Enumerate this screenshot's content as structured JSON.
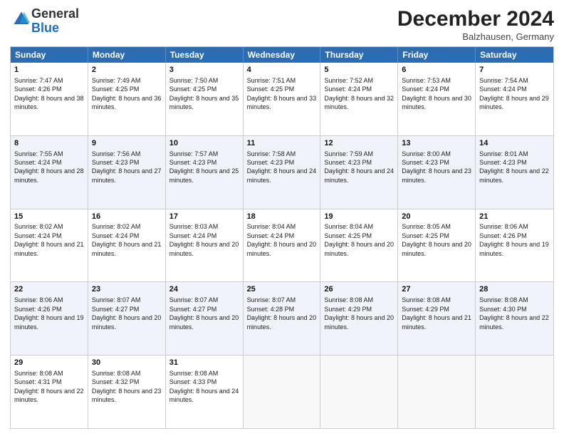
{
  "header": {
    "logo_general": "General",
    "logo_blue": "Blue",
    "month_title": "December 2024",
    "location": "Balzhausen, Germany"
  },
  "days_of_week": [
    "Sunday",
    "Monday",
    "Tuesday",
    "Wednesday",
    "Thursday",
    "Friday",
    "Saturday"
  ],
  "weeks": [
    [
      {
        "day": "1",
        "sunrise": "Sunrise: 7:47 AM",
        "sunset": "Sunset: 4:26 PM",
        "daylight": "Daylight: 8 hours and 38 minutes."
      },
      {
        "day": "2",
        "sunrise": "Sunrise: 7:49 AM",
        "sunset": "Sunset: 4:25 PM",
        "daylight": "Daylight: 8 hours and 36 minutes."
      },
      {
        "day": "3",
        "sunrise": "Sunrise: 7:50 AM",
        "sunset": "Sunset: 4:25 PM",
        "daylight": "Daylight: 8 hours and 35 minutes."
      },
      {
        "day": "4",
        "sunrise": "Sunrise: 7:51 AM",
        "sunset": "Sunset: 4:25 PM",
        "daylight": "Daylight: 8 hours and 33 minutes."
      },
      {
        "day": "5",
        "sunrise": "Sunrise: 7:52 AM",
        "sunset": "Sunset: 4:24 PM",
        "daylight": "Daylight: 8 hours and 32 minutes."
      },
      {
        "day": "6",
        "sunrise": "Sunrise: 7:53 AM",
        "sunset": "Sunset: 4:24 PM",
        "daylight": "Daylight: 8 hours and 30 minutes."
      },
      {
        "day": "7",
        "sunrise": "Sunrise: 7:54 AM",
        "sunset": "Sunset: 4:24 PM",
        "daylight": "Daylight: 8 hours and 29 minutes."
      }
    ],
    [
      {
        "day": "8",
        "sunrise": "Sunrise: 7:55 AM",
        "sunset": "Sunset: 4:24 PM",
        "daylight": "Daylight: 8 hours and 28 minutes."
      },
      {
        "day": "9",
        "sunrise": "Sunrise: 7:56 AM",
        "sunset": "Sunset: 4:23 PM",
        "daylight": "Daylight: 8 hours and 27 minutes."
      },
      {
        "day": "10",
        "sunrise": "Sunrise: 7:57 AM",
        "sunset": "Sunset: 4:23 PM",
        "daylight": "Daylight: 8 hours and 25 minutes."
      },
      {
        "day": "11",
        "sunrise": "Sunrise: 7:58 AM",
        "sunset": "Sunset: 4:23 PM",
        "daylight": "Daylight: 8 hours and 24 minutes."
      },
      {
        "day": "12",
        "sunrise": "Sunrise: 7:59 AM",
        "sunset": "Sunset: 4:23 PM",
        "daylight": "Daylight: 8 hours and 24 minutes."
      },
      {
        "day": "13",
        "sunrise": "Sunrise: 8:00 AM",
        "sunset": "Sunset: 4:23 PM",
        "daylight": "Daylight: 8 hours and 23 minutes."
      },
      {
        "day": "14",
        "sunrise": "Sunrise: 8:01 AM",
        "sunset": "Sunset: 4:23 PM",
        "daylight": "Daylight: 8 hours and 22 minutes."
      }
    ],
    [
      {
        "day": "15",
        "sunrise": "Sunrise: 8:02 AM",
        "sunset": "Sunset: 4:24 PM",
        "daylight": "Daylight: 8 hours and 21 minutes."
      },
      {
        "day": "16",
        "sunrise": "Sunrise: 8:02 AM",
        "sunset": "Sunset: 4:24 PM",
        "daylight": "Daylight: 8 hours and 21 minutes."
      },
      {
        "day": "17",
        "sunrise": "Sunrise: 8:03 AM",
        "sunset": "Sunset: 4:24 PM",
        "daylight": "Daylight: 8 hours and 20 minutes."
      },
      {
        "day": "18",
        "sunrise": "Sunrise: 8:04 AM",
        "sunset": "Sunset: 4:24 PM",
        "daylight": "Daylight: 8 hours and 20 minutes."
      },
      {
        "day": "19",
        "sunrise": "Sunrise: 8:04 AM",
        "sunset": "Sunset: 4:25 PM",
        "daylight": "Daylight: 8 hours and 20 minutes."
      },
      {
        "day": "20",
        "sunrise": "Sunrise: 8:05 AM",
        "sunset": "Sunset: 4:25 PM",
        "daylight": "Daylight: 8 hours and 20 minutes."
      },
      {
        "day": "21",
        "sunrise": "Sunrise: 8:06 AM",
        "sunset": "Sunset: 4:26 PM",
        "daylight": "Daylight: 8 hours and 19 minutes."
      }
    ],
    [
      {
        "day": "22",
        "sunrise": "Sunrise: 8:06 AM",
        "sunset": "Sunset: 4:26 PM",
        "daylight": "Daylight: 8 hours and 19 minutes."
      },
      {
        "day": "23",
        "sunrise": "Sunrise: 8:07 AM",
        "sunset": "Sunset: 4:27 PM",
        "daylight": "Daylight: 8 hours and 20 minutes."
      },
      {
        "day": "24",
        "sunrise": "Sunrise: 8:07 AM",
        "sunset": "Sunset: 4:27 PM",
        "daylight": "Daylight: 8 hours and 20 minutes."
      },
      {
        "day": "25",
        "sunrise": "Sunrise: 8:07 AM",
        "sunset": "Sunset: 4:28 PM",
        "daylight": "Daylight: 8 hours and 20 minutes."
      },
      {
        "day": "26",
        "sunrise": "Sunrise: 8:08 AM",
        "sunset": "Sunset: 4:29 PM",
        "daylight": "Daylight: 8 hours and 20 minutes."
      },
      {
        "day": "27",
        "sunrise": "Sunrise: 8:08 AM",
        "sunset": "Sunset: 4:29 PM",
        "daylight": "Daylight: 8 hours and 21 minutes."
      },
      {
        "day": "28",
        "sunrise": "Sunrise: 8:08 AM",
        "sunset": "Sunset: 4:30 PM",
        "daylight": "Daylight: 8 hours and 22 minutes."
      }
    ],
    [
      {
        "day": "29",
        "sunrise": "Sunrise: 8:08 AM",
        "sunset": "Sunset: 4:31 PM",
        "daylight": "Daylight: 8 hours and 22 minutes."
      },
      {
        "day": "30",
        "sunrise": "Sunrise: 8:08 AM",
        "sunset": "Sunset: 4:32 PM",
        "daylight": "Daylight: 8 hours and 23 minutes."
      },
      {
        "day": "31",
        "sunrise": "Sunrise: 8:08 AM",
        "sunset": "Sunset: 4:33 PM",
        "daylight": "Daylight: 8 hours and 24 minutes."
      },
      null,
      null,
      null,
      null
    ]
  ]
}
